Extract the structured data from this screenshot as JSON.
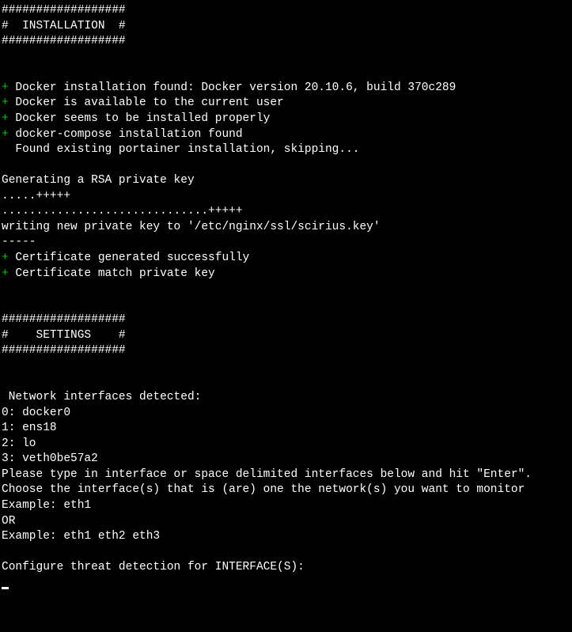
{
  "banner_installation": {
    "line1": "##################",
    "line2": "#  INSTALLATION  #",
    "line3": "##################"
  },
  "plus": "+",
  "installation_checks": [
    " Docker installation found: Docker version 20.10.6, build 370c289",
    " Docker is available to the current user",
    " Docker seems to be installed properly",
    " docker-compose installation found"
  ],
  "portainer_msg": "  Found existing portainer installation, skipping...",
  "rsa": {
    "generating": "Generating a RSA private key",
    "dots1": ".....+++++",
    "dots2": "..............................+++++",
    "writing": "writing new private key to '/etc/nginx/ssl/scirius.key'",
    "dashes": "-----"
  },
  "cert_checks": [
    " Certificate generated successfully",
    " Certificate match private key"
  ],
  "banner_settings": {
    "line1": "##################",
    "line2": "#    SETTINGS    #",
    "line3": "##################"
  },
  "interfaces": {
    "header": " Network interfaces detected:",
    "list": [
      "0: docker0",
      "1: ens18",
      "2: lo",
      "3: veth0be57a2"
    ],
    "prompt1": "Please type in interface or space delimited interfaces below and hit \"Enter\".",
    "prompt2": "Choose the interface(s) that is (are) one the network(s) you want to monitor",
    "example1": "Example: eth1",
    "or": "OR",
    "example2": "Example: eth1 eth2 eth3",
    "configure": "Configure threat detection for INTERFACE(S):"
  }
}
